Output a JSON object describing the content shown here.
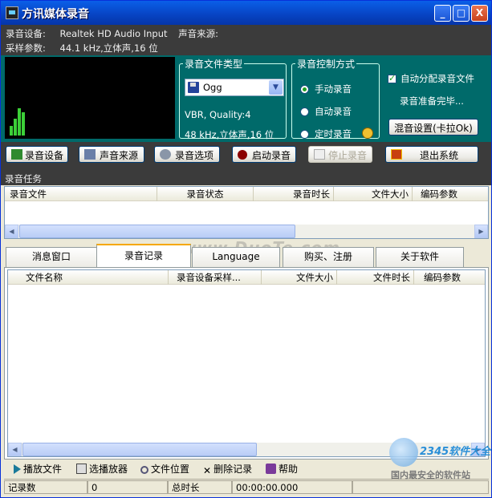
{
  "window": {
    "title": "方讯媒体录音",
    "min": "_",
    "max": "□",
    "close": "X"
  },
  "info": {
    "device_label": "录音设备:",
    "device_value": "Realtek HD Audio Input",
    "source_label": "声音来源:",
    "source_value": "",
    "params_label": "采样参数:",
    "params_value": "44.1  kHz,立体声,16  位"
  },
  "file_type": {
    "legend": "录音文件类型",
    "selected": "Ogg",
    "quality": "VBR, Quality:4",
    "format": "48   kHz,立体声,16  位"
  },
  "control": {
    "legend": "录音控制方式",
    "options": [
      {
        "label": "手动录音",
        "checked": true
      },
      {
        "label": "自动录音",
        "checked": false
      },
      {
        "label": "定时录音",
        "checked": false
      }
    ]
  },
  "auto_split": {
    "label": "自动分配录音文件",
    "checked": true
  },
  "status_msg": "录音准备完毕...",
  "mix_button": "混音设置(卡拉Ok)",
  "toolbar": {
    "device": "录音设备",
    "source": "声音来源",
    "options": "录音选项",
    "start": "启动录音",
    "stop": "停止录音",
    "exit": "退出系统"
  },
  "task_section": "录音任务",
  "task_columns": [
    "录音文件",
    "录音状态",
    "录音时长",
    "文件大小",
    "编码参数"
  ],
  "tabs": [
    {
      "label": "消息窗口",
      "active": false
    },
    {
      "label": "录音记录",
      "active": true
    },
    {
      "label": "Language",
      "active": false
    },
    {
      "label": "购买、注册",
      "active": false
    },
    {
      "label": "关于软件",
      "active": false
    }
  ],
  "record_columns": [
    "文件名称",
    "录音设备采样...",
    "文件大小",
    "文件时长",
    "编码参数"
  ],
  "bottom_toolbar": {
    "play": "播放文件",
    "player": "选播放器",
    "locate": "文件位置",
    "delete": "删除记录",
    "help": "帮助"
  },
  "statusbar": {
    "count_label": "记录数",
    "count_value": "0",
    "duration_label": "总时长",
    "duration_value": "00:00:00.000"
  },
  "watermark": "www.DuoTe.com",
  "logo": {
    "brand": "2345软件大全",
    "tagline": "国内最安全的软件站"
  },
  "vu_levels": [
    0.12,
    0.22,
    0.35,
    0.3
  ],
  "colors": {
    "teal": "#006a6a",
    "dark": "#3b3b3b",
    "vu_green": "#3cd038",
    "title_blue": "#0743c2"
  }
}
